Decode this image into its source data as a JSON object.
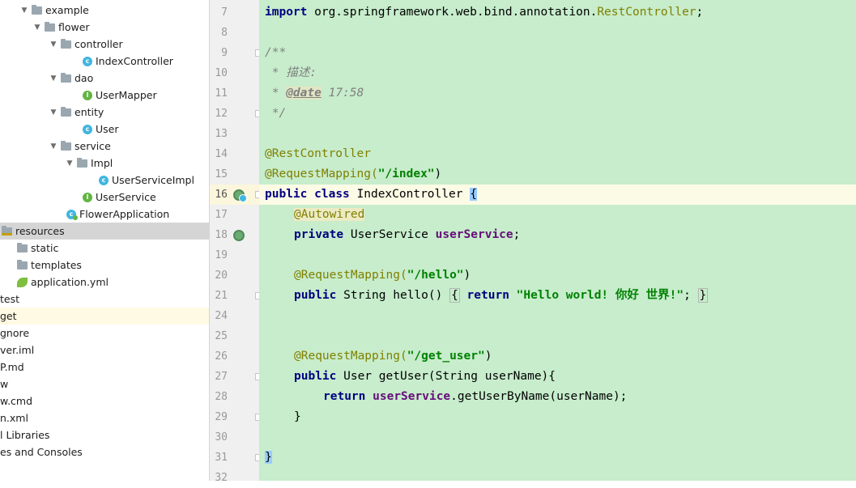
{
  "project_tree": {
    "items": [
      {
        "label": "example",
        "kind": "folder",
        "expanded": true
      },
      {
        "label": "flower",
        "kind": "folder",
        "expanded": true
      },
      {
        "label": "controller",
        "kind": "folder",
        "expanded": true
      },
      {
        "label": "IndexController",
        "kind": "class"
      },
      {
        "label": "dao",
        "kind": "folder",
        "expanded": true
      },
      {
        "label": "UserMapper",
        "kind": "interface"
      },
      {
        "label": "entity",
        "kind": "folder",
        "expanded": true
      },
      {
        "label": "User",
        "kind": "class"
      },
      {
        "label": "service",
        "kind": "folder",
        "expanded": true
      },
      {
        "label": "Impl",
        "kind": "folder",
        "expanded": true
      },
      {
        "label": "UserServiceImpl",
        "kind": "class"
      },
      {
        "label": "UserService",
        "kind": "interface"
      },
      {
        "label": "FlowerApplication",
        "kind": "spring-boot-class"
      },
      {
        "label": "resources",
        "kind": "resources-folder",
        "selected": true
      },
      {
        "label": "static",
        "kind": "folder"
      },
      {
        "label": "templates",
        "kind": "folder"
      },
      {
        "label": "application.yml",
        "kind": "yaml-file"
      },
      {
        "label": "test",
        "kind": "truncated"
      },
      {
        "label": "get",
        "kind": "truncated",
        "highlighted": true
      },
      {
        "label": "gnore",
        "kind": "truncated"
      },
      {
        "label": "ver.iml",
        "kind": "truncated"
      },
      {
        "label": "P.md",
        "kind": "truncated"
      },
      {
        "label": "w",
        "kind": "truncated"
      },
      {
        "label": "w.cmd",
        "kind": "truncated"
      },
      {
        "label": "n.xml",
        "kind": "truncated"
      },
      {
        "label": "l Libraries",
        "kind": "truncated"
      },
      {
        "label": "es and Consoles",
        "kind": "truncated"
      }
    ]
  },
  "gutter": {
    "line_numbers": [
      "7",
      "8",
      "9",
      "10",
      "11",
      "12",
      "13",
      "14",
      "15",
      "16",
      "17",
      "18",
      "19",
      "20",
      "21",
      "24",
      "25",
      "26",
      "27",
      "28",
      "29",
      "30",
      "31",
      "32"
    ],
    "active_line": "16"
  },
  "editor": {
    "code": {
      "l7_kw": "import",
      "l7_pkg": " org.springframework.web.bind.annotation.",
      "l7_cls": "RestController",
      "l7_end": ";",
      "l9": "/**",
      "l10": " * 描述:",
      "l11_pre": " * ",
      "l11_tag": "@date",
      "l11_post": " 17:58",
      "l12": " */",
      "l14": "@RestController",
      "l15_ann": "@RequestMapping(",
      "l15_str": "\"/index\"",
      "l15_end": ")",
      "l16_kw1": "public",
      "l16_kw2": "class",
      "l16_name": " IndexController ",
      "l16_brace": "{",
      "l17_ann": "@Autowired",
      "l18_kw": "private",
      "l18_type": " UserService ",
      "l18_fld": "userService",
      "l18_end": ";",
      "l20_ann": "@RequestMapping(",
      "l20_str": "\"/hello\"",
      "l20_end": ")",
      "l21_kw": "public",
      "l21_sig": " String hello() ",
      "l21_brace_open": "{",
      "l21_ret": "return",
      "l21_str": "\"Hello world! 你好 世界!\"",
      "l21_semi": ";",
      "l21_brace_close": "}",
      "l26_ann": "@RequestMapping(",
      "l26_str": "\"/get_user\"",
      "l26_end": ")",
      "l27_kw": "public",
      "l27_sig": " User getUser(String userName){",
      "l28_kw": "return",
      "l28_fld": "userService",
      "l28_rest": ".getUserByName(userName);",
      "l29": "}",
      "l31": "}"
    }
  },
  "colors": {
    "editor_bg": "#c7edcc",
    "keyword": "#000080",
    "annotation": "#808000",
    "string": "#008000",
    "field": "#660e7a",
    "comment": "#808080"
  }
}
